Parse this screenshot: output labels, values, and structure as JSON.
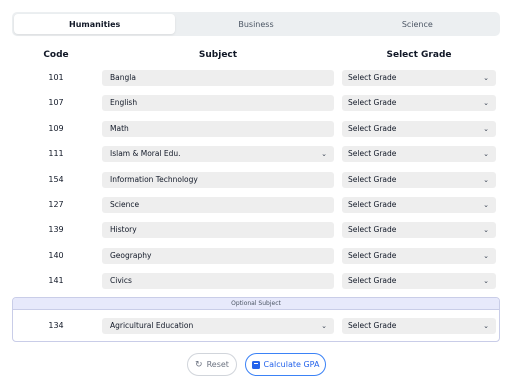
{
  "tabs": [
    {
      "label": "Humanities",
      "active": true
    },
    {
      "label": "Business",
      "active": false
    },
    {
      "label": "Science",
      "active": false
    }
  ],
  "headers": {
    "code": "Code",
    "subject": "Subject",
    "grade": "Select Grade"
  },
  "rows": [
    {
      "code": "101",
      "subject": "Bangla",
      "grade": "Select Grade"
    },
    {
      "code": "107",
      "subject": "English",
      "grade": "Select Grade"
    },
    {
      "code": "109",
      "subject": "Math",
      "grade": "Select Grade"
    },
    {
      "code": "111",
      "subject": "Islam & Moral Edu.",
      "grade": "Select Grade"
    },
    {
      "code": "154",
      "subject": "Information Technology",
      "grade": "Select Grade"
    },
    {
      "code": "127",
      "subject": "Science",
      "grade": "Select Grade"
    },
    {
      "code": "139",
      "subject": "History",
      "grade": "Select Grade"
    },
    {
      "code": "140",
      "subject": "Geography",
      "grade": "Select Grade"
    },
    {
      "code": "141",
      "subject": "Civics",
      "grade": "Select Grade"
    }
  ],
  "optional": {
    "header": "Optional Subject",
    "code": "134",
    "subject": "Agricultural Education",
    "grade": "Select Grade"
  },
  "buttons": {
    "reset": "Reset",
    "calculate": "Calculate GPA"
  },
  "colors": {
    "accent": "#2563eb",
    "optional_bg": "#e7e9fb",
    "field_bg": "#eeeeee"
  },
  "icons": {
    "dropdown": "chevron-down-icon",
    "reset": "reset-icon",
    "calculate": "calculator-icon"
  }
}
